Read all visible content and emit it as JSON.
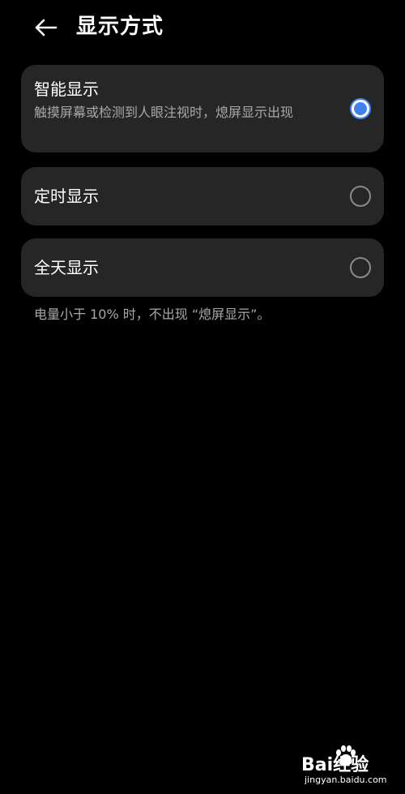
{
  "header": {
    "title": "显示方式"
  },
  "options": [
    {
      "title": "智能显示",
      "subtitle": "触摸屏幕或检测到人眼注视时，熄屏显示出现",
      "selected": true
    },
    {
      "title": "定时显示",
      "selected": false
    },
    {
      "title": "全天显示",
      "selected": false
    }
  ],
  "footnote": "电量小于 10% 时，不出现 “熄屏显示”。",
  "watermark": {
    "brand": "Bai经验",
    "url": "jingyan.baidu.com"
  },
  "colors": {
    "accent": "#3f82ef",
    "card_bg": "#262626",
    "background": "#000000",
    "secondary_text": "#a8a8a8"
  },
  "icons": {
    "back": "arrow-left-icon",
    "watermark": "paw-icon"
  }
}
